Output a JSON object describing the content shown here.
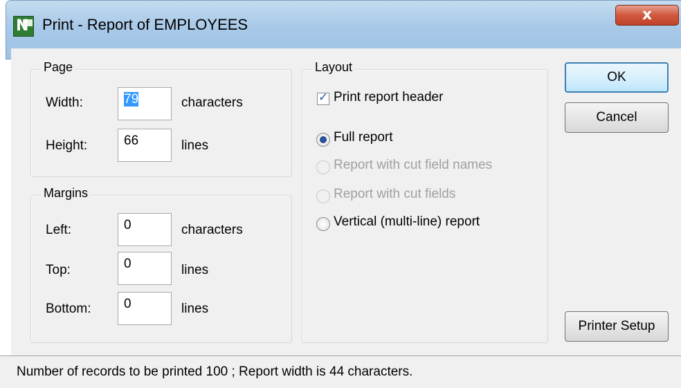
{
  "window": {
    "title": "Print - Report of EMPLOYEES",
    "close_glyph": "x",
    "icon_letter": "N"
  },
  "page_group": {
    "legend": "Page",
    "width_label": "Width:",
    "width_value": "79",
    "width_unit": "characters",
    "height_label": "Height:",
    "height_value": "66",
    "height_unit": "lines"
  },
  "margins_group": {
    "legend": "Margins",
    "left_label": "Left:",
    "left_value": "0",
    "left_unit": "characters",
    "top_label": "Top:",
    "top_value": "0",
    "top_unit": "lines",
    "bottom_label": "Bottom:",
    "bottom_value": "0",
    "bottom_unit": "lines"
  },
  "layout_group": {
    "legend": "Layout",
    "print_header_label": "Print report header",
    "print_header_checked": true,
    "options": [
      {
        "label": "Full report",
        "selected": true,
        "enabled": true
      },
      {
        "label": "Report with cut field names",
        "selected": false,
        "enabled": false
      },
      {
        "label": "Report with cut fields",
        "selected": false,
        "enabled": false
      },
      {
        "label": "Vertical (multi-line) report",
        "selected": false,
        "enabled": true
      }
    ]
  },
  "buttons": {
    "ok": "OK",
    "cancel": "Cancel",
    "printer_setup": "Printer Setup"
  },
  "status_bar": {
    "text": "Number of records to be printed 100  ;  Report width is 44 characters."
  },
  "colors": {
    "titlebar": "#a8c9e8",
    "close_button": "#c9462c",
    "selection": "#3399ff",
    "dialog_bg": "#f0f0f0"
  }
}
